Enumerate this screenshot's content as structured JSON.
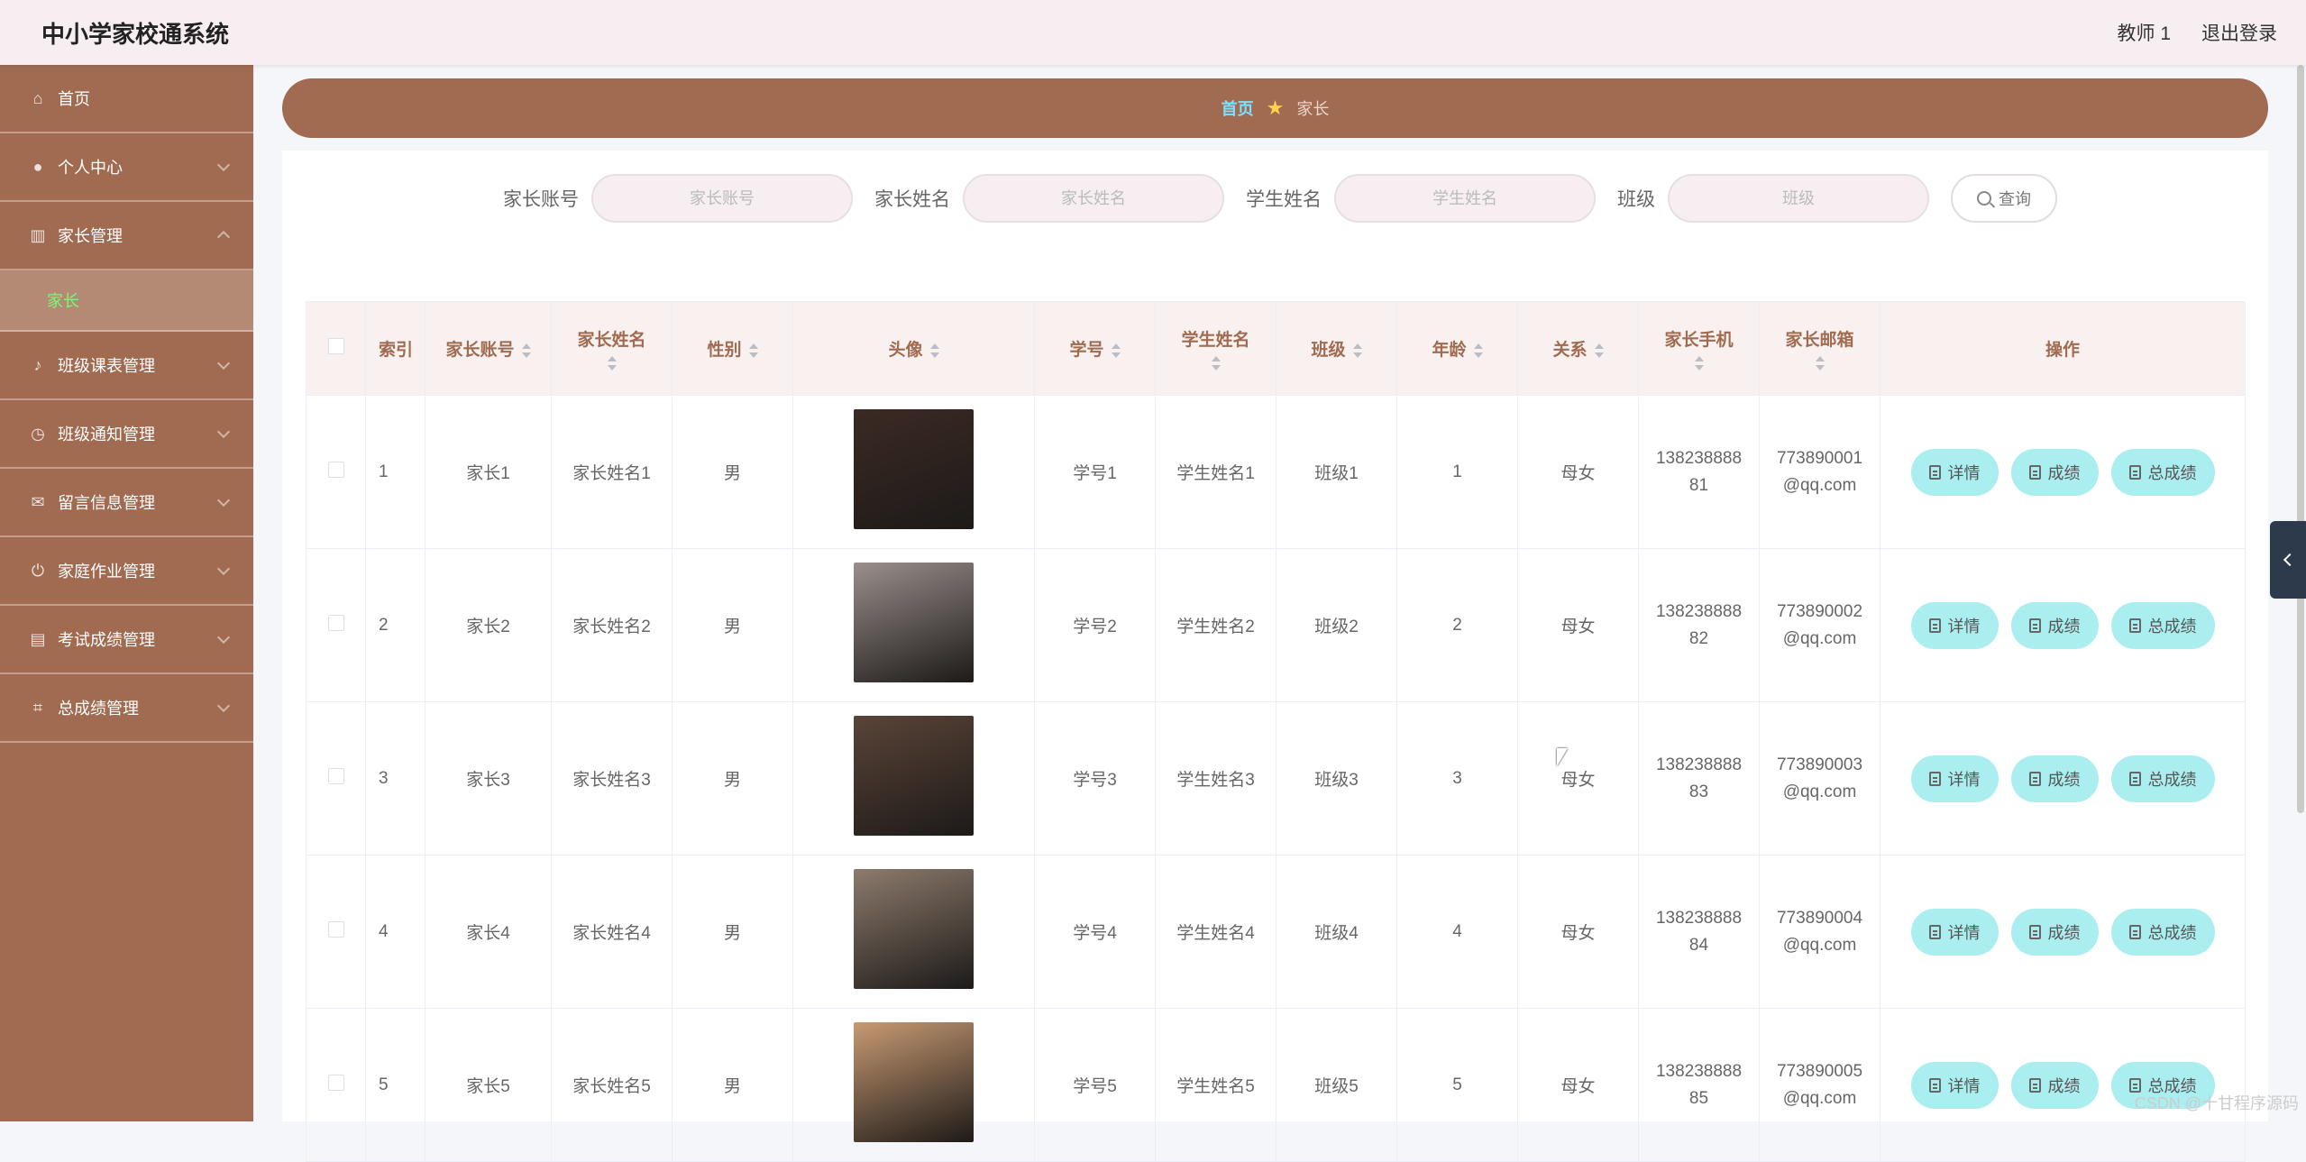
{
  "app": {
    "title": "中小学家校通系统"
  },
  "header": {
    "user": "教师 1",
    "logout": "退出登录"
  },
  "sidebar": {
    "items": [
      {
        "label": "首页",
        "icon": "home-icon",
        "expanded": false
      },
      {
        "label": "个人中心",
        "icon": "user-icon",
        "expanded": false
      },
      {
        "label": "家长管理",
        "icon": "chart-icon",
        "expanded": true
      },
      {
        "label": "班级课表管理",
        "icon": "mic-icon",
        "expanded": false
      },
      {
        "label": "班级通知管理",
        "icon": "clock-icon",
        "expanded": false
      },
      {
        "label": "留言信息管理",
        "icon": "message-icon",
        "expanded": false
      },
      {
        "label": "家庭作业管理",
        "icon": "power-icon",
        "expanded": false
      },
      {
        "label": "考试成绩管理",
        "icon": "clipboard-icon",
        "expanded": false
      },
      {
        "label": "总成绩管理",
        "icon": "crop-icon",
        "expanded": false
      }
    ],
    "sub_item": "家长"
  },
  "breadcrumb": {
    "home": "首页",
    "current": "家长"
  },
  "search": {
    "fields": [
      {
        "label": "家长账号",
        "placeholder": "家长账号"
      },
      {
        "label": "家长姓名",
        "placeholder": "家长姓名"
      },
      {
        "label": "学生姓名",
        "placeholder": "学生姓名"
      },
      {
        "label": "班级",
        "placeholder": "班级"
      }
    ],
    "query_button": "查询"
  },
  "table": {
    "headers": [
      "索引",
      "家长账号",
      "家长姓名",
      "性别",
      "头像",
      "学号",
      "学生姓名",
      "班级",
      "年龄",
      "关系",
      "家长手机",
      "家长邮箱",
      "操作"
    ],
    "actions": [
      "详情",
      "成绩",
      "总成绩"
    ],
    "rows": [
      {
        "index": "1",
        "account": "家长1",
        "name": "家长姓名1",
        "gender": "男",
        "student_no": "学号1",
        "student_name": "学生姓名1",
        "class": "班级1",
        "age": "1",
        "relation": "母女",
        "phone_a": "138238888",
        "phone_b": "81",
        "email_a": "773890001",
        "email_b": "@qq.com",
        "avatar_color": "#3b2a24"
      },
      {
        "index": "2",
        "account": "家长2",
        "name": "家长姓名2",
        "gender": "男",
        "student_no": "学号2",
        "student_name": "学生姓名2",
        "class": "班级2",
        "age": "2",
        "relation": "母女",
        "phone_a": "138238888",
        "phone_b": "82",
        "email_a": "773890002",
        "email_b": "@qq.com",
        "avatar_color": "#9a8f8c"
      },
      {
        "index": "3",
        "account": "家长3",
        "name": "家长姓名3",
        "gender": "男",
        "student_no": "学号3",
        "student_name": "学生姓名3",
        "class": "班级3",
        "age": "3",
        "relation": "母女",
        "phone_a": "138238888",
        "phone_b": "83",
        "email_a": "773890003",
        "email_b": "@qq.com",
        "avatar_color": "#5a4438"
      },
      {
        "index": "4",
        "account": "家长4",
        "name": "家长姓名4",
        "gender": "男",
        "student_no": "学号4",
        "student_name": "学生姓名4",
        "class": "班级4",
        "age": "4",
        "relation": "母女",
        "phone_a": "138238888",
        "phone_b": "84",
        "email_a": "773890004",
        "email_b": "@qq.com",
        "avatar_color": "#8d7b6d"
      },
      {
        "index": "5",
        "account": "家长5",
        "name": "家长姓名5",
        "gender": "男",
        "student_no": "学号5",
        "student_name": "学生姓名5",
        "class": "班级5",
        "age": "5",
        "relation": "母女",
        "phone_a": "138238888",
        "phone_b": "85",
        "email_a": "773890005",
        "email_b": "@qq.com",
        "avatar_color": "#c89a72"
      }
    ]
  },
  "watermark": "CSDN @十甘程序源码",
  "colors": {
    "sidebar": "#a06b50",
    "topbar": "#f6eef0",
    "action": "#aaeef0",
    "submenu_text": "#7cf77a"
  }
}
